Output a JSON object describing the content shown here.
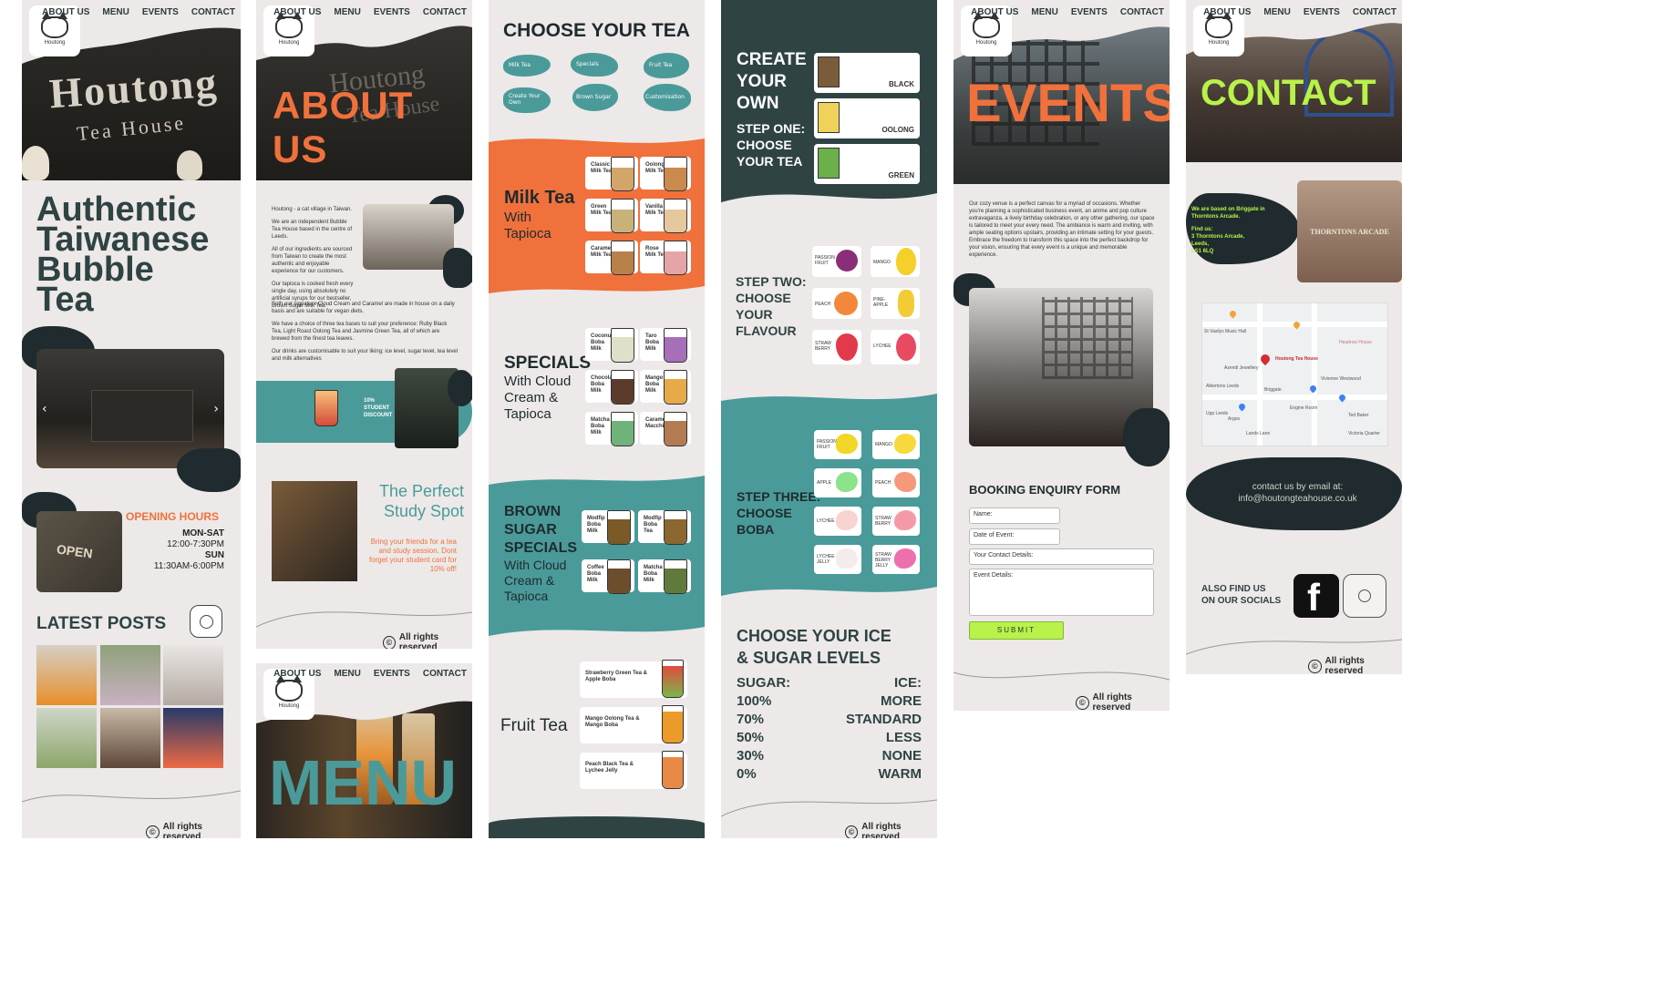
{
  "nav": {
    "about": "ABOUT US",
    "menu": "MENU",
    "events": "EVENTS",
    "contact": "CONTACT"
  },
  "logo": {
    "text": "Houtong"
  },
  "footer": {
    "copy": "©",
    "text": "All rights reserved"
  },
  "home": {
    "hero_sign": "Houtong",
    "hero_sign2": "Tea House",
    "title": [
      "Authentic",
      "Taiwanese",
      "Bubble",
      "Tea"
    ],
    "carousel_prev": "‹",
    "carousel_next": "›",
    "open_sign": "OPEN",
    "opening_title": "OPENING HOURS",
    "opening": [
      {
        "day": "MON-SAT",
        "time": "12:00-7:30PM"
      },
      {
        "day": "SUN",
        "time": "11:30AM-6:00PM"
      }
    ],
    "latest_posts": "LATEST POSTS"
  },
  "about": {
    "title": "ABOUT US",
    "paragraphs": [
      "Houtong - a cat village in Taiwan.",
      "We are an independent Bubble Tea House based in the centre of Leeds.",
      "All of our ingredients are sourced from Taiwan to create the most authentic and enjoyable experience for our customers.",
      "Our tapioca is cooked fresh every single day, using absolutely no artificial syrups for our bestseller, Brown Sugar Milk Tea.",
      "Both our signature Cloud Cream and Caramel are made in house on a daily basis and are suitable for vegan diets.",
      "We have a choice of three tea bases to suit your preference: Ruby Black Tea, Light Roast Oolong Tea and Jasmine Green Tea, all of which are brewed from the finest tea leaves.",
      "Our drinks are customisable to suit your liking: ice level, sugar level, tea level and milk alternatives"
    ],
    "discount": "10% STUDENT DISCOUNT",
    "study_title": "The Perfect Study Spot",
    "study_text": "Bring your friends for a tea and study session. Dont forget your student card for 10% off!"
  },
  "menu_page": {
    "title": "MENU"
  },
  "menu": {
    "choose": "CHOOSE YOUR TEA",
    "choices": [
      "Milk Tea",
      "Specials",
      "Fruit Tea",
      "Create Your Own",
      "Brown Sugar",
      "Customisation"
    ],
    "milk_title": "Milk Tea",
    "milk_sub": [
      "With",
      "Tapioca"
    ],
    "milk_items": [
      "Classic Milk Tea",
      "Oolong Milk Tea",
      "Green Milk Tea",
      "Vanilla Milk Tea",
      "Caramel Milk Tea",
      "Rose Milk Tea"
    ],
    "specials_title": "SPECIALS",
    "specials_sub": [
      "With Cloud",
      "Cream &",
      "Tapioca"
    ],
    "specials_items": [
      "Coconut Boba Milk",
      "Taro Boba Milk",
      "Chocolate Boba Milk",
      "Mango Boba Milk",
      "Matcha Boba Milk",
      "Caramel Macchiato"
    ],
    "brown_title": [
      "BROWN",
      "SUGAR",
      "SPECIALS"
    ],
    "brown_sub": [
      "With Cloud",
      "Cream &",
      "Tapioca"
    ],
    "brown_items": [
      "Modfip Boba Milk",
      "Modfip Boba Tea",
      "Coffee Boba Milk",
      "Matcha Boba Milk"
    ],
    "fruit_title": "Fruit Tea",
    "fruit_items": [
      "Strawberry Green Tea & Apple Boba",
      "Mango Oolong Tea & Mango Boba",
      "Peach Black Tea & Lychee Jelly"
    ]
  },
  "create": {
    "title": [
      "CREATE",
      "YOUR",
      "OWN"
    ],
    "step1": [
      "STEP ONE:",
      "CHOOSE",
      "YOUR TEA"
    ],
    "teas": [
      "BLACK",
      "OOLONG",
      "GREEN"
    ],
    "step2": [
      "STEP TWO:",
      "CHOOSE",
      "YOUR",
      "FLAVOUR"
    ],
    "flavours": [
      "PASSION FRUIT",
      "MANGO",
      "PEACH",
      "PINE-APPLE",
      "STRAW BERRY",
      "LYCHEE"
    ],
    "step3": [
      "STEP THREE:",
      "CHOOSE",
      "BOBA"
    ],
    "boba": [
      "PASSION FRUIT",
      "MANGO",
      "APPLE",
      "PEACH",
      "LYCHEE",
      "STRAW BERRY",
      "LYCHEE JELLY",
      "STRAW BERRY JELLY"
    ],
    "ice_title": [
      "CHOOSE YOUR ICE",
      "& SUGAR LEVELS"
    ],
    "sugar_label": "SUGAR:",
    "ice_label": "ICE:",
    "sugar": [
      "100%",
      "70%",
      "50%",
      "30%",
      "0%"
    ],
    "ice": [
      "MORE",
      "STANDARD",
      "LESS",
      "NONE",
      "WARM"
    ]
  },
  "events": {
    "title": "EVENTS",
    "text": "Our cozy venue is a perfect canvas for a myriad of occasions. Whether you're planning a sophisticated business event, an anime and pop culture extravaganza, a lively birthday celebration, or any other gathering, our space is tailored to meet your every need. The ambiance is warm and inviting, with ample seating options upstairs, providing an intimate setting for your guests. Embrace the freedom to transform this space into the perfect backdrop for your vision, ensuring that every event is a unique and memorable experience.",
    "form_title": "BOOKING ENQUIRY FORM",
    "fields": [
      "Name:",
      "Date of Event:",
      "Your Contact Details:",
      "Event Details:"
    ],
    "submit": "SUBMIT"
  },
  "contact": {
    "title": "CONTACT",
    "based": "We are based on Briggate in Thorntons Arcade.",
    "find": "Find us:",
    "address": [
      "3 Thorntons Arcade,",
      "Leeds,",
      "LS1 6LQ"
    ],
    "arcade": "THORNTONS ARCADE",
    "map_label": "Houtong Tea House",
    "map_places": [
      "St Vasilys Music Hall",
      "Headrow House",
      "Azendi Jewellery",
      "Albertons Leeds",
      "Vivienne Westwood",
      "Briggate",
      "Upp Leeds",
      "Engine Room",
      "Argos",
      "Lands Lane",
      "Victoria Quarter",
      "Ted Baker"
    ],
    "email_line1": "contact us by email at:",
    "email": "info@houtongteahouse.co.uk",
    "socials": [
      "ALSO FIND US",
      "ON OUR SOCIALS"
    ],
    "fb": "f"
  },
  "colors": {
    "teal": "#4b9a9a",
    "orange": "#f0713c",
    "dark": "#2f4343",
    "navy": "#1f2b2e",
    "lime": "#b8f24a",
    "panel": "#ece9e8"
  },
  "icons": [
    "cat-logo-icon",
    "instagram-icon",
    "facebook-icon",
    "copyright-icon",
    "chevron-left-icon",
    "chevron-right-icon",
    "map-pin-icon"
  ]
}
